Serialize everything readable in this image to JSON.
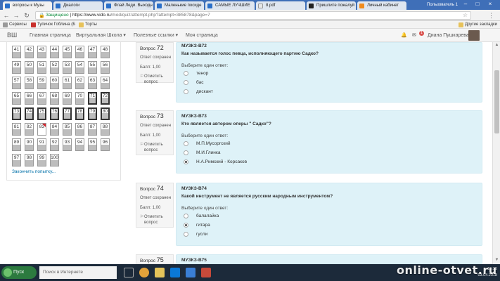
{
  "browser": {
    "tabs": [
      {
        "label": "вопросы к Музы",
        "icon": "moodle-icon",
        "active": true
      },
      {
        "label": "Диалоги",
        "icon": "vk-icon"
      },
      {
        "label": "Флай Леди. Выходн",
        "icon": "vk-icon"
      },
      {
        "label": "Маленькие посиде",
        "icon": "vk-icon"
      },
      {
        "label": "САМЫЕ ЛУЧШИЕ",
        "icon": "vk-icon"
      },
      {
        "label": "8.pdf",
        "icon": "pdf-icon"
      },
      {
        "label": "Пришлите пожалуй",
        "icon": "znanija-icon"
      },
      {
        "label": "Личный кабинет",
        "icon": "orange-icon"
      }
    ],
    "window_user": "Пользователь 1",
    "url": {
      "secure_label": "Защищено",
      "host": "https://www.vido.ru",
      "path": "/mod/quiz/attempt.php?attempt=385878&page=7"
    },
    "bookmarks": [
      {
        "label": "Сервисы",
        "icon": "apps-icon"
      },
      {
        "label": "Тупичок Гоблина (Б",
        "icon": "bookmark-red-icon"
      },
      {
        "label": "Торты",
        "icon": "folder-icon"
      },
      {
        "label": "Другие закладки",
        "icon": "folder-icon"
      }
    ]
  },
  "navbar": {
    "brand": "ВШ",
    "links": [
      "Главная страница",
      "Виртуальная Школа ▾",
      "Полезные ссылки ▾",
      "Моя страница"
    ],
    "notification_count": "1",
    "user_name": "Диана Пушкарева ▾"
  },
  "quiz_nav": {
    "rows": [
      [
        "41",
        "42",
        "43",
        "44",
        "45",
        "46",
        "47",
        "48"
      ],
      [
        "49",
        "50",
        "51",
        "52",
        "53",
        "54",
        "55",
        "56"
      ],
      [
        "57",
        "58",
        "59",
        "60",
        "61",
        "62",
        "63",
        "64"
      ],
      [
        "65",
        "66",
        "67",
        "68",
        "69",
        "70",
        "71",
        "72"
      ],
      [
        "73",
        "74",
        "75",
        "76",
        "77",
        "78",
        "79",
        "80"
      ],
      [
        "81",
        "82",
        "83",
        "84",
        "85",
        "86",
        "87",
        "88"
      ],
      [
        "89",
        "90",
        "91",
        "92",
        "93",
        "94",
        "95",
        "96"
      ],
      [
        "97",
        "98",
        "99",
        "100"
      ]
    ],
    "current": [
      "71",
      "72",
      "73",
      "74",
      "75",
      "76",
      "77",
      "78",
      "79",
      "80"
    ],
    "unanswered": [
      "83"
    ],
    "flagged": [
      "83"
    ],
    "finish_label": "Закончить попытку..."
  },
  "questions": [
    {
      "label": "Вопрос",
      "number": "72",
      "status": "Ответ сохранен",
      "points": "Балл: 1,00",
      "flag_label": "Отметить вопрос",
      "code": "МУЗКЗ-В72",
      "text": "Как называется голос певца, исполняющего партию Садко?",
      "prompt": "Выберите один ответ:",
      "options": [
        "тенор",
        "бас",
        "дискант"
      ],
      "selected": 0
    },
    {
      "label": "Вопрос",
      "number": "73",
      "status": "Ответ сохранен",
      "points": "Балл: 1,00",
      "flag_label": "Отметить вопрос",
      "code": "МУЗКЗ-В73",
      "text": "Кто является автором оперы \" Садко\"?",
      "prompt": "Выберите один ответ:",
      "options": [
        "М.П.Мусоргский",
        "М.И.Глинка",
        "Н.А.Римский - Корсаков"
      ],
      "selected": 2
    },
    {
      "label": "Вопрос",
      "number": "74",
      "status": "Ответ сохранен",
      "points": "Балл: 1,00",
      "flag_label": "Отметить вопрос",
      "code": "МУЗКЗ-В74",
      "text": "Какой инструмент не является русским народным инструментом?",
      "prompt": "Выберите один ответ:",
      "options": [
        "балалайка",
        "гитара",
        "гусли"
      ],
      "selected": 1
    },
    {
      "label": "Вопрос",
      "number": "75",
      "code": "МУЗКЗ-В75"
    }
  ],
  "taskbar": {
    "start_label": "Пуск",
    "search_placeholder": "Поиск в Интернете",
    "time": "15:35",
    "date": "03.04.2018"
  },
  "watermark": "online-otvet.ru"
}
